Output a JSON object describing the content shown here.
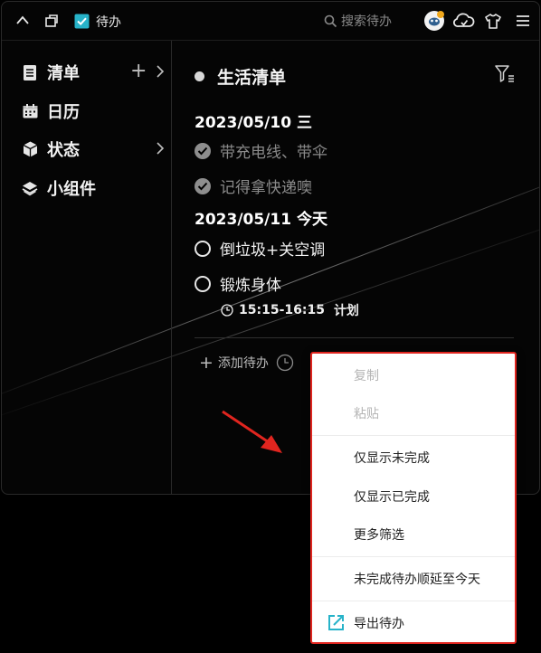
{
  "titlebar": {
    "app_name": "待办",
    "search_placeholder": "搜索待办"
  },
  "sidebar": {
    "items": [
      {
        "label": "清单"
      },
      {
        "label": "日历"
      },
      {
        "label": "状态"
      },
      {
        "label": "小组件"
      }
    ],
    "add_symbol": "+"
  },
  "main": {
    "list_title": "生活清单",
    "groups": [
      {
        "date": "2023/05/10  三",
        "tasks": [
          {
            "text": "带充电线、带伞",
            "done": true
          },
          {
            "text": "记得拿快递噢",
            "done": true
          }
        ]
      },
      {
        "date": "2023/05/11  今天",
        "tasks": [
          {
            "text": "倒垃圾+关空调",
            "done": false
          },
          {
            "text": "锻炼身体",
            "done": false
          }
        ]
      }
    ],
    "schedule": {
      "time": "15:15-16:15",
      "label": "计划"
    },
    "add_label": "添加待办",
    "add_symbol": "+"
  },
  "context_menu": {
    "items": [
      {
        "label": "复制",
        "disabled": true
      },
      {
        "label": "粘贴",
        "disabled": true
      },
      {
        "label": "仅显示未完成",
        "disabled": false
      },
      {
        "label": "仅显示已完成",
        "disabled": false
      },
      {
        "label": "更多筛选",
        "disabled": false
      },
      {
        "label": "未完成待办顺延至今天",
        "disabled": false
      },
      {
        "label": "导出待办",
        "disabled": false
      }
    ]
  },
  "colors": {
    "accent": "#27b3c9",
    "highlight_border": "#e0251f",
    "arrow": "#e0251f"
  }
}
